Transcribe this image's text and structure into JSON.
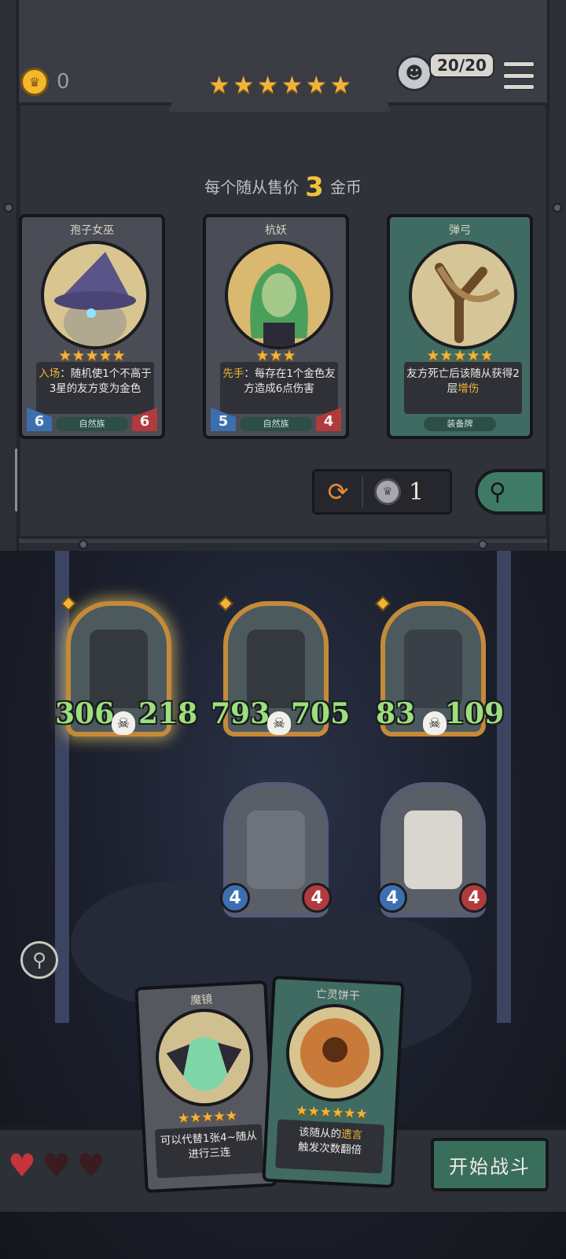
{
  "header": {
    "gold": "0",
    "tier_stars": 6,
    "hp": "20/20"
  },
  "shop": {
    "price_prefix": "每个随从售价",
    "price_value": "3",
    "price_suffix": "金币",
    "cards": [
      {
        "name": "孢子女巫",
        "stars": 5,
        "desc_highlight": "入场",
        "desc_rest": "：随机使1个不高于3星的友方变为金色",
        "tribe": "自然族",
        "attack": "6",
        "health": "6"
      },
      {
        "name": "杭妖",
        "stars": 3,
        "desc_highlight": "先手",
        "desc_rest": "：每存在1个金色友方造成6点伤害",
        "tribe": "自然族",
        "attack": "5",
        "health": "4"
      },
      {
        "name": "弹弓",
        "stars": 5,
        "desc_plain": "友方死亡后该随从获得2层",
        "desc_highlight": "增伤",
        "tribe": "装备牌"
      }
    ],
    "refresh_cost": "1"
  },
  "board": {
    "minions": [
      {
        "attack": "306",
        "health": "218",
        "golden": true,
        "selected": true
      },
      {
        "attack": "793",
        "health": "705",
        "golden": true,
        "selected": false
      },
      {
        "attack": "83",
        "health": "109",
        "golden": true,
        "selected": false
      },
      {
        "attack": "4",
        "health": "4",
        "golden": false
      },
      {
        "attack": "4",
        "health": "4",
        "golden": false
      }
    ]
  },
  "hand": [
    {
      "name": "魔镜",
      "stars": 5,
      "desc": "可以代替1张4~随从进行三连"
    },
    {
      "name": "亡灵饼干",
      "stars": 6,
      "desc_prefix": "该随从的",
      "desc_highlight": "遗言",
      "desc_suffix": "触发次数翻倍"
    }
  ],
  "footer": {
    "lives_total": 3,
    "lives_remaining": 1,
    "start_label": "开始战斗"
  },
  "colors": {
    "gold_star": "#f2b33a",
    "attack_blue": "#3c6fb0",
    "health_red": "#b03a3c",
    "buffed_stat_green": "#9be07a",
    "equip_card_teal": "#3f6b62"
  },
  "icons": [
    "crown-coin-icon",
    "menu-icon",
    "refresh-icon",
    "silver-coin-icon",
    "search-icon",
    "skull-icon",
    "heart-icon",
    "magnifier-icon"
  ]
}
